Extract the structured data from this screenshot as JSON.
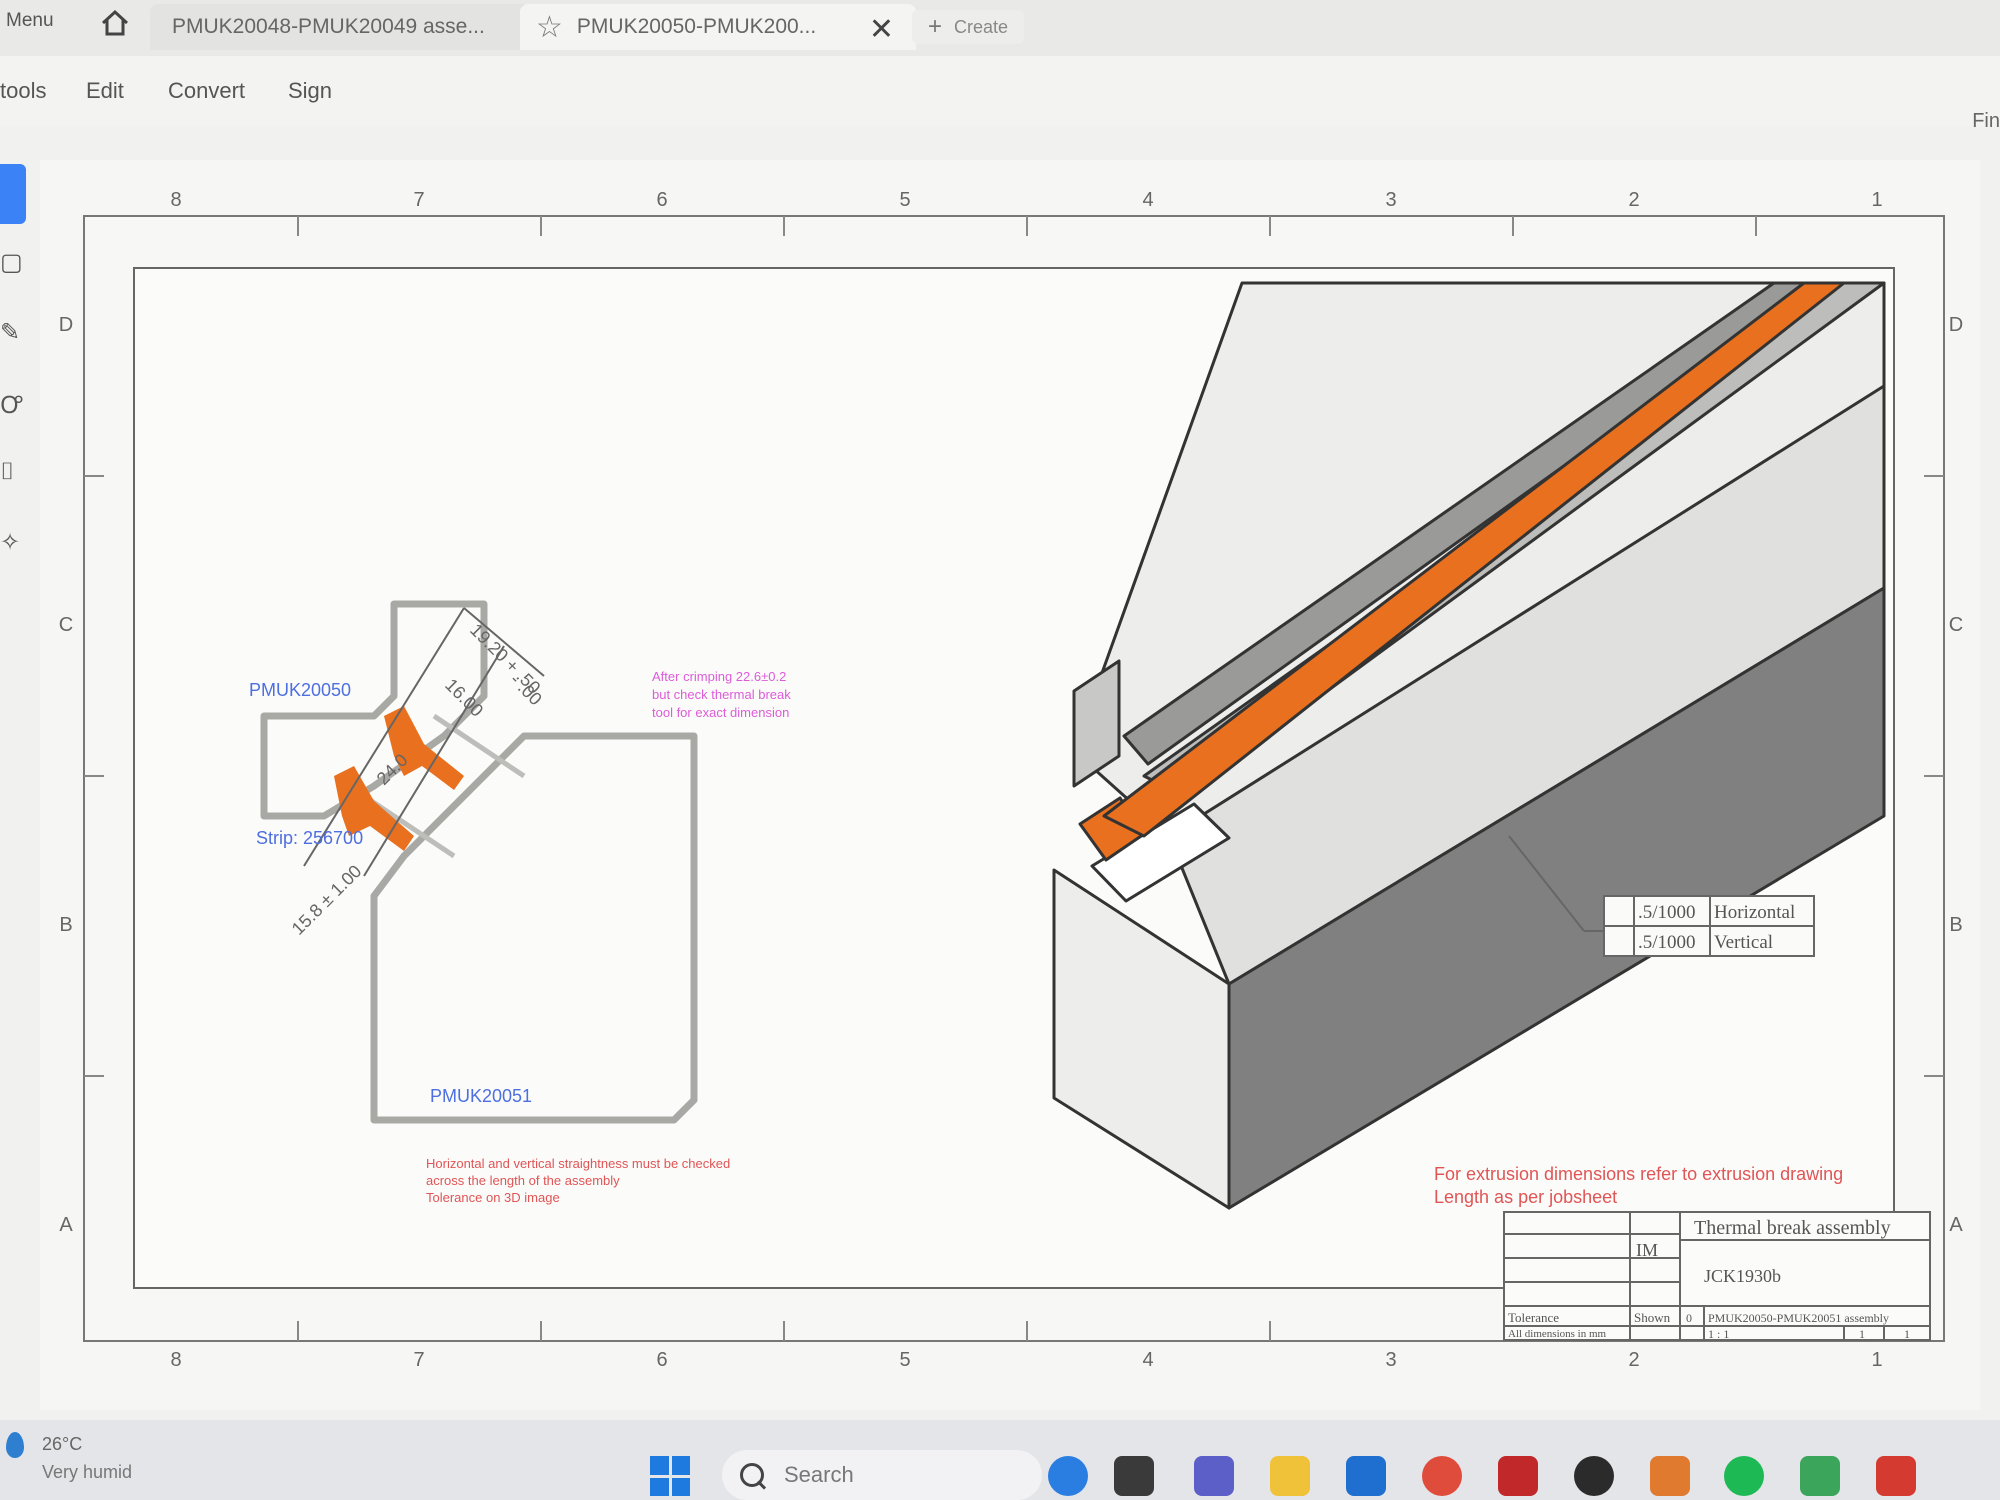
{
  "tabs": {
    "menu": "Menu",
    "tab1": "PMUK20048-PMUK20049 asse...",
    "tab2": "PMUK20050-PMUK200...",
    "create": "Create"
  },
  "menubar": {
    "tools": "tools",
    "edit": "Edit",
    "convert": "Convert",
    "sign": "Sign",
    "find": "Fin"
  },
  "border": {
    "top_numbers": [
      "8",
      "7",
      "6",
      "5",
      "4",
      "3",
      "2",
      "1"
    ],
    "bottom_numbers": [
      "8",
      "7",
      "6",
      "5",
      "4",
      "3",
      "2",
      "1"
    ],
    "left_letters": [
      "D",
      "C",
      "B",
      "A"
    ],
    "right_letters": [
      "D",
      "C",
      "B",
      "A"
    ]
  },
  "drawing": {
    "part_a": "PMUK20050",
    "part_b": "PMUK20051",
    "strip": "Strip: 256700",
    "dim_overall": "19.20 + .50",
    "dim_overall_tol": "- .00",
    "dim_16": "16.00",
    "dim_24": "24.0",
    "dim_15": "15.8 ± 1.00",
    "crimp_note": [
      "After crimping 22.6±0.2",
      "but check thermal break",
      "tool for exact dimension"
    ],
    "straight_note": [
      "Horizontal and vertical straightness must be checked",
      "across the length of the assembly",
      "Tolerance on 3D image"
    ],
    "tol_rows": [
      {
        "value": ".5/1000",
        "label": "Horizontal"
      },
      {
        "value": ".5/1000",
        "label": "Vertical"
      }
    ],
    "red_note_1": "For extrusion dimensions refer to extrusion drawing",
    "red_note_2": "Length as per jobsheet"
  },
  "title_block": {
    "title": "Thermal break assembly",
    "drawn_by": "IM",
    "number": "JCK1930b",
    "tolerance": "Tolerance",
    "shown": "Shown",
    "all_dims": "All dimensions in mm",
    "rev": "0",
    "dwg_no": "PMUK20050-PMUK20051 assembly",
    "scale": "1 : 1",
    "sheet": "1",
    "of": "1"
  },
  "taskbar": {
    "temp": "26°C",
    "condition": "Very humid",
    "search": "Search"
  },
  "colors": {
    "orange": "#e8701e",
    "annotation_blue": "#4d6fe0",
    "annotation_magenta": "#dc5cd8",
    "annotation_red": "#e05555",
    "tool_accent": "#3b82f6"
  }
}
